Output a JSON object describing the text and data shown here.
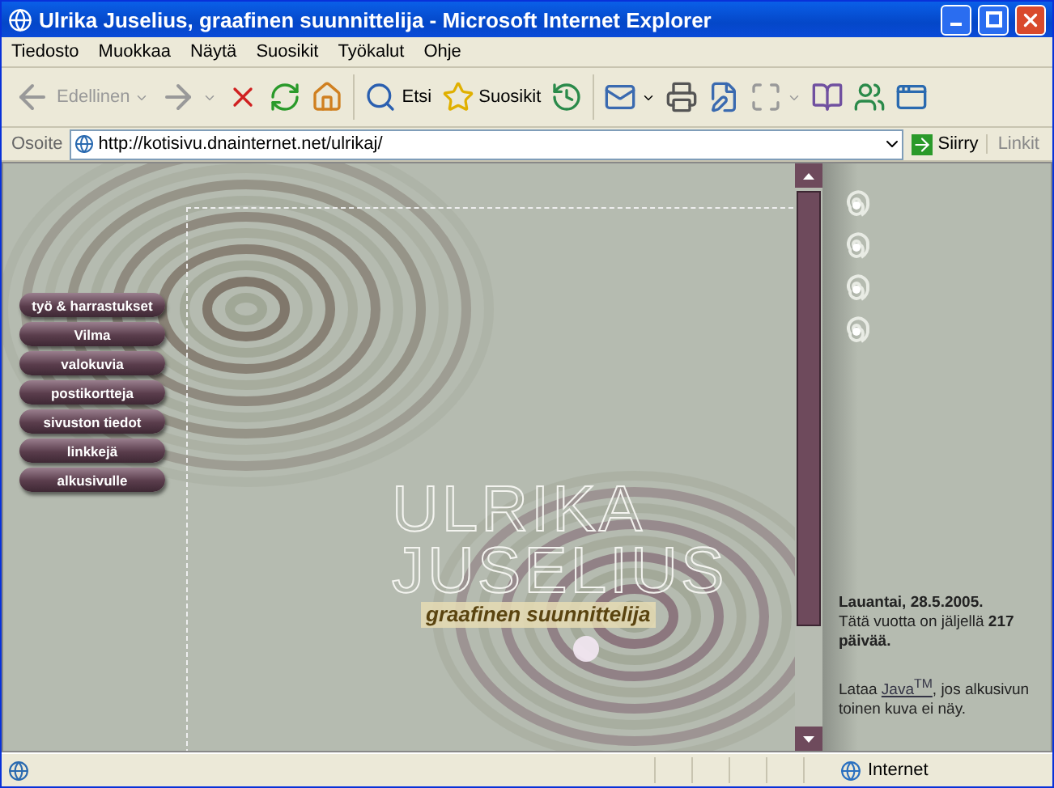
{
  "window": {
    "title": "Ulrika Juselius, graafinen suunnittelija - Microsoft Internet Explorer"
  },
  "menu": [
    "Tiedosto",
    "Muokkaa",
    "Näytä",
    "Suosikit",
    "Työkalut",
    "Ohje"
  ],
  "toolbar": [
    {
      "kind": "back",
      "label": "Edellinen",
      "disabled": true,
      "dropdown": true
    },
    {
      "kind": "forward",
      "disabled": true,
      "dropdown": true
    },
    {
      "kind": "stop",
      "disabled": false
    },
    {
      "kind": "refresh",
      "disabled": false
    },
    {
      "kind": "home",
      "disabled": false
    },
    {
      "kind": "separator"
    },
    {
      "kind": "search",
      "label": "Etsi",
      "disabled": false
    },
    {
      "kind": "favorites",
      "label": "Suosikit",
      "disabled": false
    },
    {
      "kind": "history",
      "disabled": false
    },
    {
      "kind": "separator"
    },
    {
      "kind": "mail",
      "disabled": false,
      "dropdown": true
    },
    {
      "kind": "print",
      "disabled": false
    },
    {
      "kind": "edit",
      "disabled": false
    },
    {
      "kind": "fullscreen",
      "disabled": true,
      "dropdown": true
    },
    {
      "kind": "research",
      "disabled": false
    },
    {
      "kind": "messenger",
      "disabled": false
    },
    {
      "kind": "window",
      "disabled": false
    }
  ],
  "address": {
    "label": "Osoite",
    "value": "http://kotisivu.dnainternet.net/ulrikaj/",
    "go": "Siirry",
    "links": "Linkit"
  },
  "nav": [
    "työ & harrastukset",
    "Vilma",
    "valokuvia",
    "postikortteja",
    "sivuston tiedot",
    "linkkejä",
    "alkusivulle"
  ],
  "logo": {
    "first": "ULRIKA",
    "last": "JUSELIUS",
    "tagline": "graafinen suunnittelija"
  },
  "sidebar": {
    "date": "Lauantai, 28.5.2005.",
    "remaining": "Tätä vuotta on jäljellä **217 päivää.**",
    "java": {
      "before": "Lataa ",
      "link": "Java",
      "mark": "TM",
      "after": ", jos alkusivun toinen kuva ei näy."
    }
  },
  "status": {
    "zone": "Internet"
  }
}
